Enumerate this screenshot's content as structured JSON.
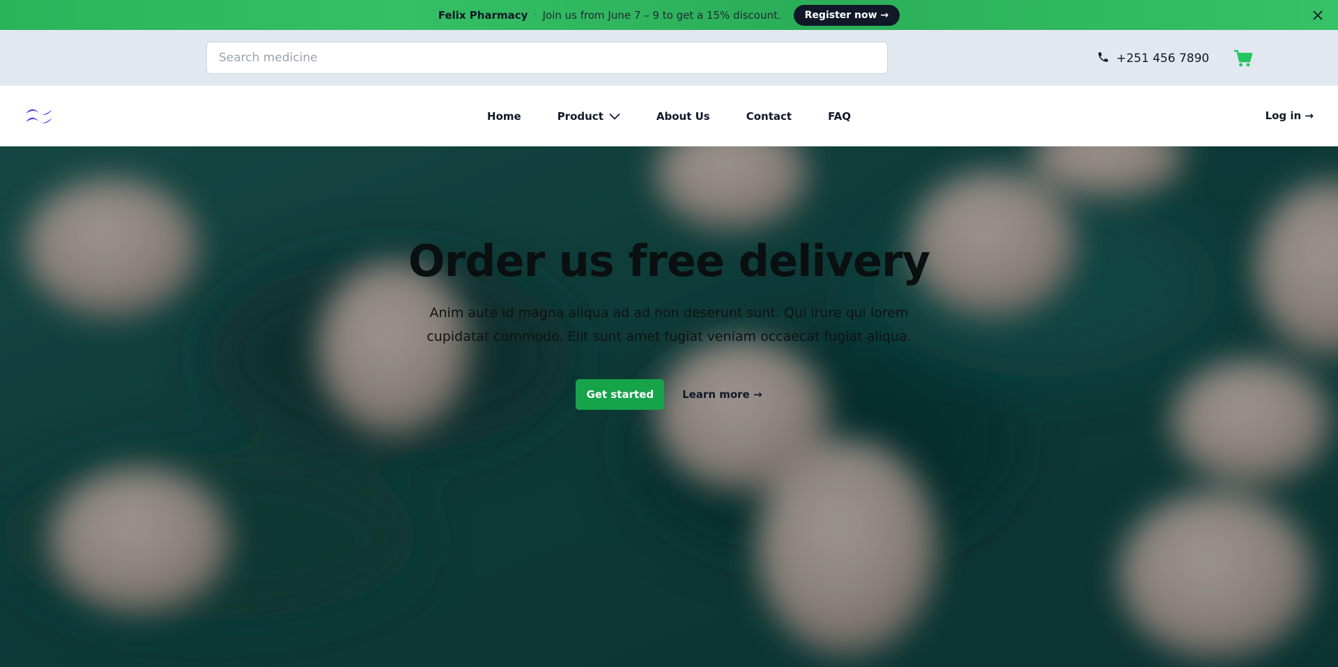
{
  "banner": {
    "brand": "Felix Pharmacy",
    "separator": "·",
    "promo": "Join us from June 7 – 9 to get a 15% discount.",
    "register_label": "Register now →"
  },
  "search": {
    "placeholder": "Search medicine",
    "value": ""
  },
  "contact": {
    "phone": "+251 456 7890"
  },
  "nav": {
    "items": [
      {
        "label": "Home"
      },
      {
        "label": "Product"
      },
      {
        "label": "About Us"
      },
      {
        "label": "Contact"
      },
      {
        "label": "FAQ"
      }
    ],
    "login_label": "Log in →"
  },
  "hero": {
    "title": "Order us free delivery",
    "text": "Anim aute id magna aliqua ad ad non deserunt sunt. Qui irure qui lorem cupidatat commodo. Elit sunt amet fugiat veniam occaecat fugiat aliqua.",
    "primary_cta": "Get started",
    "secondary_cta": "Learn more →"
  },
  "colors": {
    "banner": "#2bb35a",
    "primary": "#16a34a",
    "dark": "#111827",
    "logo": "#4f46e5",
    "cart": "#22c55e"
  },
  "icons": {
    "phone": "phone-icon",
    "cart": "cart-icon",
    "close": "close-icon",
    "chevron": "chevron-down-icon",
    "logo": "logo-icon"
  }
}
